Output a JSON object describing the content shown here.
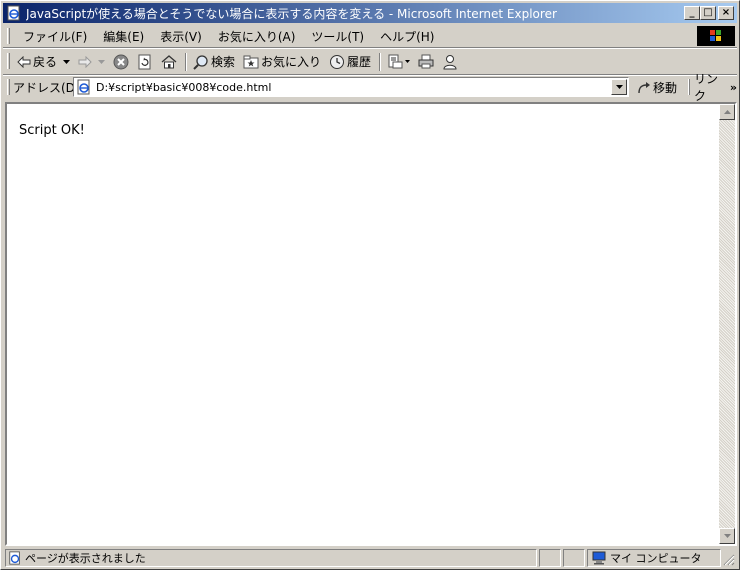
{
  "window": {
    "title": "JavaScriptが使える場合とそうでない場合に表示する内容を変える - Microsoft Internet Explorer",
    "title_icon": "ie-page-icon",
    "buttons": {
      "minimize": "_",
      "maximize": "□",
      "close": "×"
    }
  },
  "menu": {
    "items": [
      "ファイル(F)",
      "編集(E)",
      "表示(V)",
      "お気に入り(A)",
      "ツール(T)",
      "ヘルプ(H)"
    ]
  },
  "toolbar": {
    "back_label": "戻る",
    "search_label": "検索",
    "favorites_label": "お気に入り",
    "history_label": "履歴"
  },
  "address": {
    "label": "アドレス(D)",
    "url": "D:¥script¥basic¥008¥code.html",
    "go_label": "移動",
    "links_label": "リンク"
  },
  "page": {
    "body_text": "Script OK!"
  },
  "status": {
    "message": "ページが表示されました",
    "zone": "マイ コンピュータ"
  },
  "colors": {
    "title_start": "#0a246a",
    "title_end": "#a6caf0",
    "chrome": "#d4d0c8"
  }
}
